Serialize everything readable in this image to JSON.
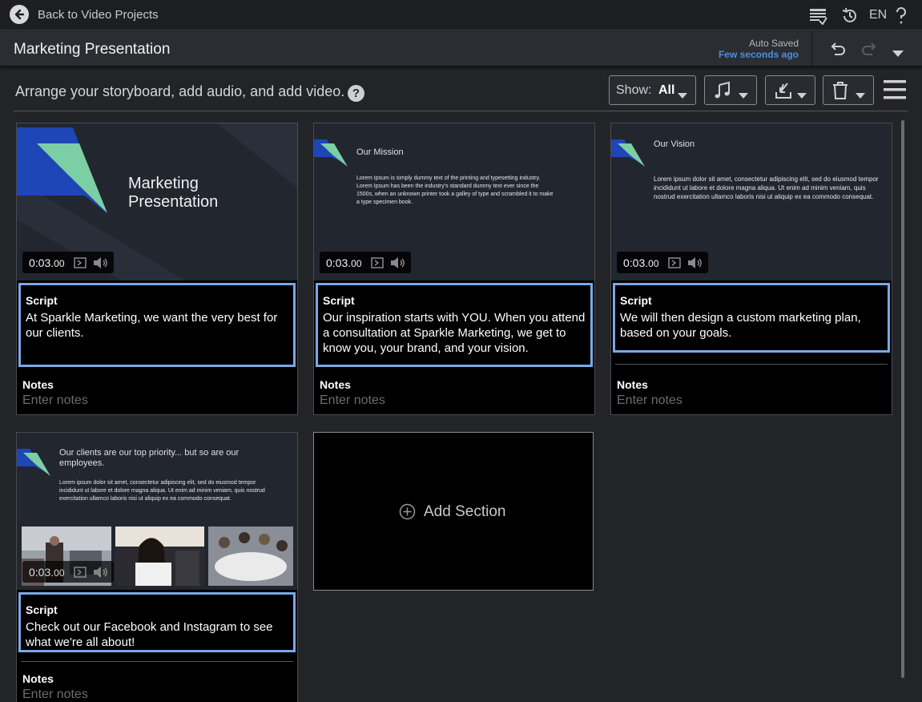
{
  "topbar": {
    "back_label": "Back to Video Projects",
    "language": "EN",
    "icons": [
      "captions-icon",
      "history-icon",
      "help-icon"
    ]
  },
  "titlebar": {
    "project_title": "Marketing Presentation",
    "autosave_status": "Auto Saved",
    "autosave_time": "Few seconds ago"
  },
  "toolbar": {
    "instructions": "Arrange your storyboard, add audio, and add video.",
    "show_label": "Show:",
    "show_value": "All",
    "help_glyph": "?"
  },
  "sections": [
    {
      "slide_title": "Marketing Presentation",
      "slide_title_line1": "Marketing",
      "slide_title_line2": "Presentation",
      "duration_main": "0:03.",
      "duration_frac": "00",
      "script_label": "Script",
      "script_text": "At Sparkle Marketing, we want the very best for our clients.",
      "notes_label": "Notes",
      "notes_placeholder": "Enter notes"
    },
    {
      "slide_heading": "Our Mission",
      "slide_body": "Lorem Ipsum is simply dummy text of the printing and typesetting industry. Lorem Ipsum has been the industry's standard dummy text ever since the 1500s, when an unknown printer took a galley of type and scrambled it to make a type specimen book.",
      "duration_main": "0:03.",
      "duration_frac": "00",
      "script_label": "Script",
      "script_text": "Our inspiration starts with YOU. When you attend a consultation at Sparkle Marketing, we get to know you, your brand, and your vision.",
      "notes_label": "Notes",
      "notes_placeholder": "Enter notes"
    },
    {
      "slide_heading": "Our Vision",
      "slide_body": "Lorem ipsum dolor sit amet, consectetur adipiscing elit, sed do eiusmod tempor incididunt ut labore et dolore magna aliqua. Ut enim ad minim veniam, quis nostrud exercitation ullamco laboris nisi ut aliquip ex ea commodo consequat.",
      "duration_main": "0:03.",
      "duration_frac": "00",
      "script_label": "Script",
      "script_text": "We will then design a custom marketing plan, based on your goals.",
      "notes_label": "Notes",
      "notes_placeholder": "Enter notes"
    },
    {
      "slide_heading": "Our clients are our top priority... but so are our employees.",
      "slide_body": "Lorem ipsum dolor sit amet, consectetur adipiscing elit, sed do eiusmod tempor incididunt ut labore et dolore magna aliqua. Ut enim ad minim veniam, quis nostrud exercitation ullamco laboris nisi ut aliquip ex ea commodo consequat.",
      "duration_main": "0:03.",
      "duration_frac": "00",
      "script_label": "Script",
      "script_text": "Check out our Facebook and Instagram to see what we're all about!",
      "notes_label": "Notes",
      "notes_placeholder": "Enter notes"
    }
  ],
  "add_section_label": "Add Section",
  "colors": {
    "accent_blue": "#4a90d9",
    "script_border": "#7aa8e8",
    "slide_bg": "#1f2330",
    "logo_blue": "#1f46b8",
    "logo_green": "#7ccfa4"
  }
}
